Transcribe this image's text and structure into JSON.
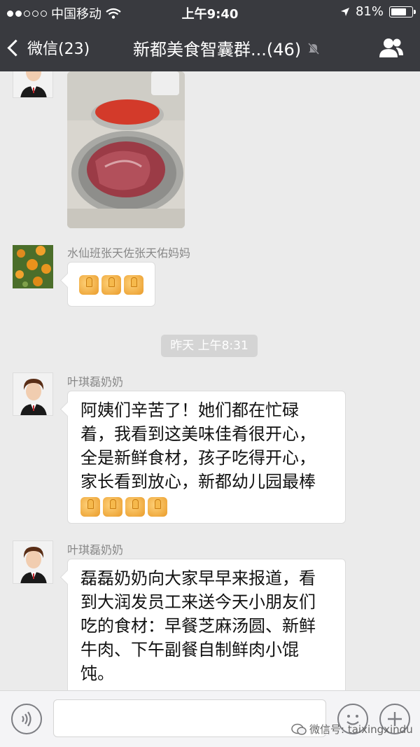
{
  "status_bar": {
    "carrier": "中国移动",
    "time": "上午9:40",
    "battery": "81%",
    "battery_level": 0.81
  },
  "nav": {
    "back_label": "微信(23)",
    "title": "新都美食智囊群...(46)"
  },
  "messages": [
    {
      "sender": "",
      "type": "image",
      "image_desc": "photo-of-meat"
    },
    {
      "sender": "水仙班张天佐张天佑妈妈",
      "type": "emoji",
      "thumbs": 3
    },
    {
      "type": "timestamp",
      "text": "昨天  上午8:31"
    },
    {
      "sender": "叶琪磊奶奶",
      "type": "text",
      "lines": [
        "阿姨们辛苦了！她们都在忙碌",
        "着，我看到这美味佳肴很开心，",
        "全是新鲜食材，孩子吃得开心，",
        "家长看到放心，新都幼儿园最棒"
      ],
      "thumbs": 4
    },
    {
      "sender": "叶琪磊奶奶",
      "type": "text",
      "lines": [
        "磊磊奶奶向大家早早来报道，看",
        "到大润发员工来送今天小朋友们",
        "吃的食材：早餐芝麻汤圆、新鲜",
        "牛肉、下午副餐自制鲜肉小馄",
        "饨。"
      ]
    }
  ],
  "input_bar": {
    "watermark": "微信号: taixingxindu"
  },
  "icons": {
    "back": "chevron-left-icon",
    "mute": "mute-bell-icon",
    "group": "people-icon",
    "voice": "voice-icon",
    "emoji": "emoji-icon",
    "plus": "plus-icon",
    "wifi": "wifi-icon",
    "location": "location-arrow-icon",
    "battery": "battery-icon"
  }
}
